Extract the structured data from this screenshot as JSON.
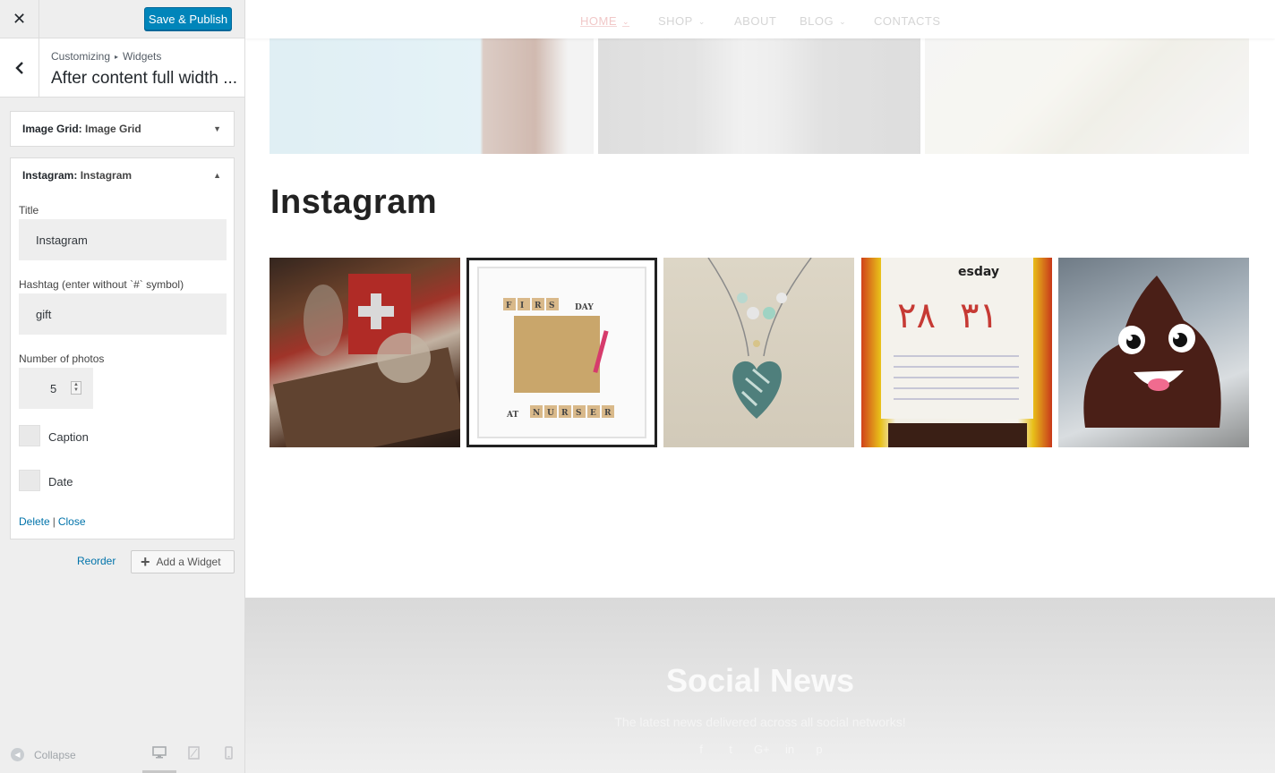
{
  "header": {
    "close_glyph": "✕",
    "save_label": "Save & Publish"
  },
  "section": {
    "back_glyph": "‹",
    "breadcrumb": [
      "Customizing",
      "Widgets"
    ],
    "breadcrumb_sep": "▸",
    "title": "After content full width ..."
  },
  "widgets": [
    {
      "type": "Image Grid:",
      "instance": "Image Grid",
      "arrow": "▼",
      "expanded": false
    },
    {
      "type": "Instagram:",
      "instance": "Instagram",
      "arrow": "▲",
      "expanded": true
    }
  ],
  "form": {
    "title_label": "Title",
    "title_value": "Instagram",
    "hashtag_label": "Hashtag (enter without `#` symbol)",
    "hashtag_value": "gift",
    "count_label": "Number of photos",
    "count_value": "5",
    "caption_label": "Caption",
    "caption_checked": false,
    "date_label": "Date",
    "date_checked": false,
    "delete_label": "Delete",
    "link_sep": "|",
    "close_label": "Close"
  },
  "actions": {
    "reorder_label": "Reorder",
    "add_widget_plus": "+",
    "add_widget_label": "Add a Widget"
  },
  "footer": {
    "collapse_label": "Collapse",
    "collapse_icon": "arrow-left-circle-icon",
    "devices": [
      "desktop-icon",
      "tablet-icon",
      "mobile-icon"
    ],
    "active_device": "desktop"
  },
  "preview": {
    "nav": [
      {
        "label": "HOME",
        "has_submenu": true,
        "active": true
      },
      {
        "label": "SHOP",
        "has_submenu": true,
        "active": false
      },
      {
        "label": "ABOUT",
        "has_submenu": false,
        "active": false
      },
      {
        "label": "BLOG",
        "has_submenu": true,
        "active": false
      },
      {
        "label": "CONTACTS",
        "has_submenu": false,
        "active": false
      }
    ],
    "nav_chevron": "⌄",
    "instagram_title": "Instagram",
    "social_title": "Social News",
    "social_subtitle": "The latest news delivered across all social networks!",
    "social_icons": [
      "f",
      "t",
      "G+",
      "in",
      "p"
    ]
  },
  "colors": {
    "accent": "#0085ba",
    "link": "#0073aa",
    "sidebar_bg": "#eeeeee"
  }
}
